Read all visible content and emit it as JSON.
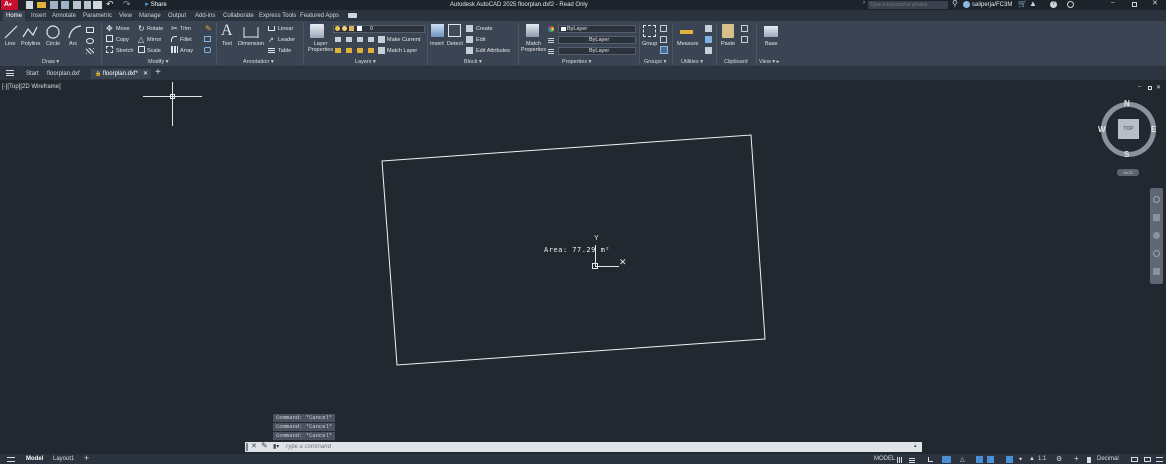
{
  "titlebar": {
    "title": "Autodesk AutoCAD 2025  floorplan.dxf2 - Read Only",
    "share": "Share",
    "search_placeholder": "Type a keyword or phrase",
    "user": "saliperja/FC3M"
  },
  "ribbon_tabs": [
    "Home",
    "Insert",
    "Annotate",
    "Parametric",
    "View",
    "Manage",
    "Output",
    "Add-ins",
    "Collaborate",
    "Express Tools",
    "Featured Apps"
  ],
  "draw": {
    "line": "Line",
    "polyline": "Polyline",
    "circle": "Circle",
    "arc": "Arc",
    "panel": "Draw"
  },
  "modify": {
    "move": "Move",
    "rotate": "Rotate",
    "trim": "Trim",
    "copy": "Copy",
    "mirror": "Mirror",
    "fillet": "Fillet",
    "stretch": "Stretch",
    "scale": "Scale",
    "array": "Array",
    "panel": "Modify"
  },
  "annotation": {
    "text": "Text",
    "dimension": "Dimension",
    "linear": "Linear",
    "leader": "Leader",
    "table": "Table",
    "panel": "Annotation"
  },
  "layers": {
    "layer_properties_1": "Layer",
    "layer_properties_2": "Properties",
    "layer_value": "0",
    "make_current": "Make Current",
    "match_layer": "Match Layer",
    "panel": "Layers"
  },
  "block": {
    "insert": "Insert",
    "detect": "Detect",
    "create": "Create",
    "edit": "Edit",
    "edit_attributes": "Edit Attributes",
    "panel": "Block"
  },
  "properties": {
    "match_1": "Match",
    "match_2": "Properties",
    "color": "ByLayer",
    "linetype": "ByLayer",
    "lineweight": "ByLayer",
    "panel": "Properties"
  },
  "groups": {
    "group": "Group",
    "panel": "Groups"
  },
  "utilities": {
    "measure": "Measure",
    "panel": "Utilities"
  },
  "clipboard": {
    "paste": "Paste",
    "panel": "Clipboard"
  },
  "view": {
    "base": "Base",
    "panel": "View"
  },
  "file_tabs": {
    "start": "Start",
    "tab1": "floorplan.dxf",
    "tab2": "floorplan.dxf*"
  },
  "viewport": {
    "label": "[-][Top][2D Wireframe]",
    "area_text": "Area: 77.29 m²",
    "ucs_y": "Y",
    "viewcube": {
      "n": "N",
      "s": "S",
      "e": "E",
      "w": "W",
      "top": "TOP",
      "wcs": "WCS"
    }
  },
  "command": {
    "history": [
      "Command: *Cancel*",
      "Command: *Cancel*",
      "Command: *Cancel*"
    ],
    "placeholder": "Type a command"
  },
  "status": {
    "model_tab": "Model",
    "layout_tab": "Layout1",
    "model": "MODEL",
    "scale": "1:1",
    "units": "Decimal"
  }
}
